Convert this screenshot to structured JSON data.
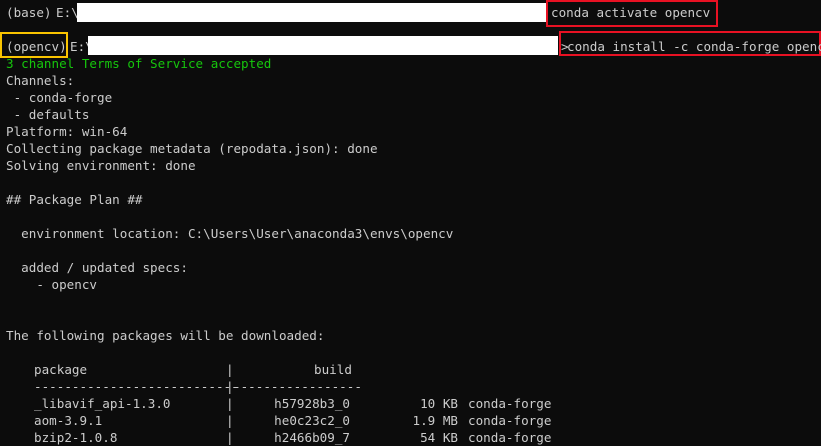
{
  "terminal": {
    "line1": {
      "env": "(base)",
      "drive": "E:\\",
      "command": "conda activate opencv"
    },
    "line2": {
      "env": "(opencv)",
      "drive": "E:\\",
      "command": "conda install -c conda-forge opencv",
      "prompt_char": ">"
    },
    "tos_message": "3 channel Terms of Service accepted",
    "channels_header": "Channels:",
    "channels": [
      " - conda-forge",
      " - defaults"
    ],
    "platform": "Platform: win-64",
    "collecting": "Collecting package metadata (repodata.json): done",
    "solving": "Solving environment: done",
    "package_plan": "## Package Plan ##",
    "env_location": "  environment location: C:\\Users\\User\\anaconda3\\envs\\opencv",
    "added_specs": "  added / updated specs:",
    "spec_item": "    - opencv",
    "download_header": "The following packages will be downloaded:",
    "table": {
      "col_package": "package",
      "col_build": "build",
      "sep": "|",
      "divider_left": "---------------------------",
      "divider_right": "-----------------",
      "rows": [
        {
          "package": "_libavif_api-1.3.0",
          "build": "h57928b3_0",
          "size": "10 KB",
          "channel": "conda-forge"
        },
        {
          "package": "aom-3.9.1",
          "build": "he0c23c2_0",
          "size": "1.9 MB",
          "channel": "conda-forge"
        },
        {
          "package": "bzip2-1.0.8",
          "build": "h2466b09_7",
          "size": "54 KB",
          "channel": "conda-forge"
        }
      ]
    }
  },
  "colors": {
    "background": "#0c0c0c",
    "text": "#cccccc",
    "success_green": "#16c60c",
    "highlight_red": "#e81123",
    "highlight_yellow": "#f9c400",
    "redaction": "#ffffff"
  }
}
